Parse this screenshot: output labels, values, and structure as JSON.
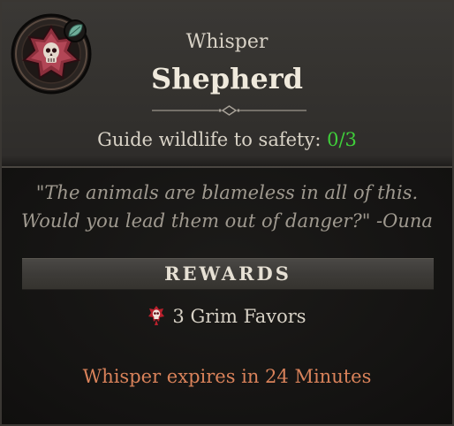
{
  "header": {
    "category": "Whisper",
    "title": "Shepherd",
    "objective_label": "Guide wildlife to safety:",
    "objective_progress": "0/3",
    "progress_color": "#3fcf3a",
    "emblem_icon": "whisper-skull-emblem-icon",
    "badge_icon": "leaf-icon"
  },
  "quote": {
    "line1": "\"The animals are blameless in all of this.",
    "line2": "Would you lead them out of danger?\" -Ouna"
  },
  "rewards": {
    "heading": "REWARDS",
    "items": [
      {
        "label": "3 Grim Favors",
        "icon": "grim-favor-skull-icon"
      }
    ]
  },
  "expiry": {
    "text": "Whisper expires in 24 Minutes",
    "color": "#d9825a"
  }
}
